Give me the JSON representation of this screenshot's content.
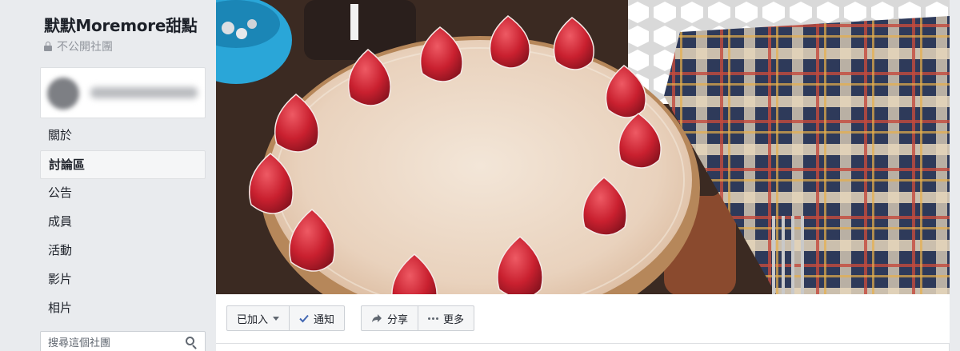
{
  "group": {
    "name": "默默Moremore甜點",
    "privacy": "不公開社團"
  },
  "nav": {
    "items": [
      {
        "label": "關於",
        "active": false
      },
      {
        "label": "討論區",
        "active": true
      },
      {
        "label": "公告",
        "active": false
      },
      {
        "label": "成員",
        "active": false
      },
      {
        "label": "活動",
        "active": false
      },
      {
        "label": "影片",
        "active": false
      },
      {
        "label": "相片",
        "active": false
      }
    ]
  },
  "search": {
    "placeholder": "搜尋這個社團"
  },
  "actions": {
    "joined_label": "已加入",
    "notify_label": "通知",
    "share_label": "分享",
    "more_label": "更多"
  },
  "colors": {
    "accent": "#4267b2",
    "sidebar_bg": "#e9ebee"
  },
  "icons": {
    "privacy": "lock-icon",
    "search": "search-icon",
    "joined": "chevron-down-icon",
    "notify": "check-icon",
    "share": "share-icon",
    "more": "more-dots-icon"
  }
}
